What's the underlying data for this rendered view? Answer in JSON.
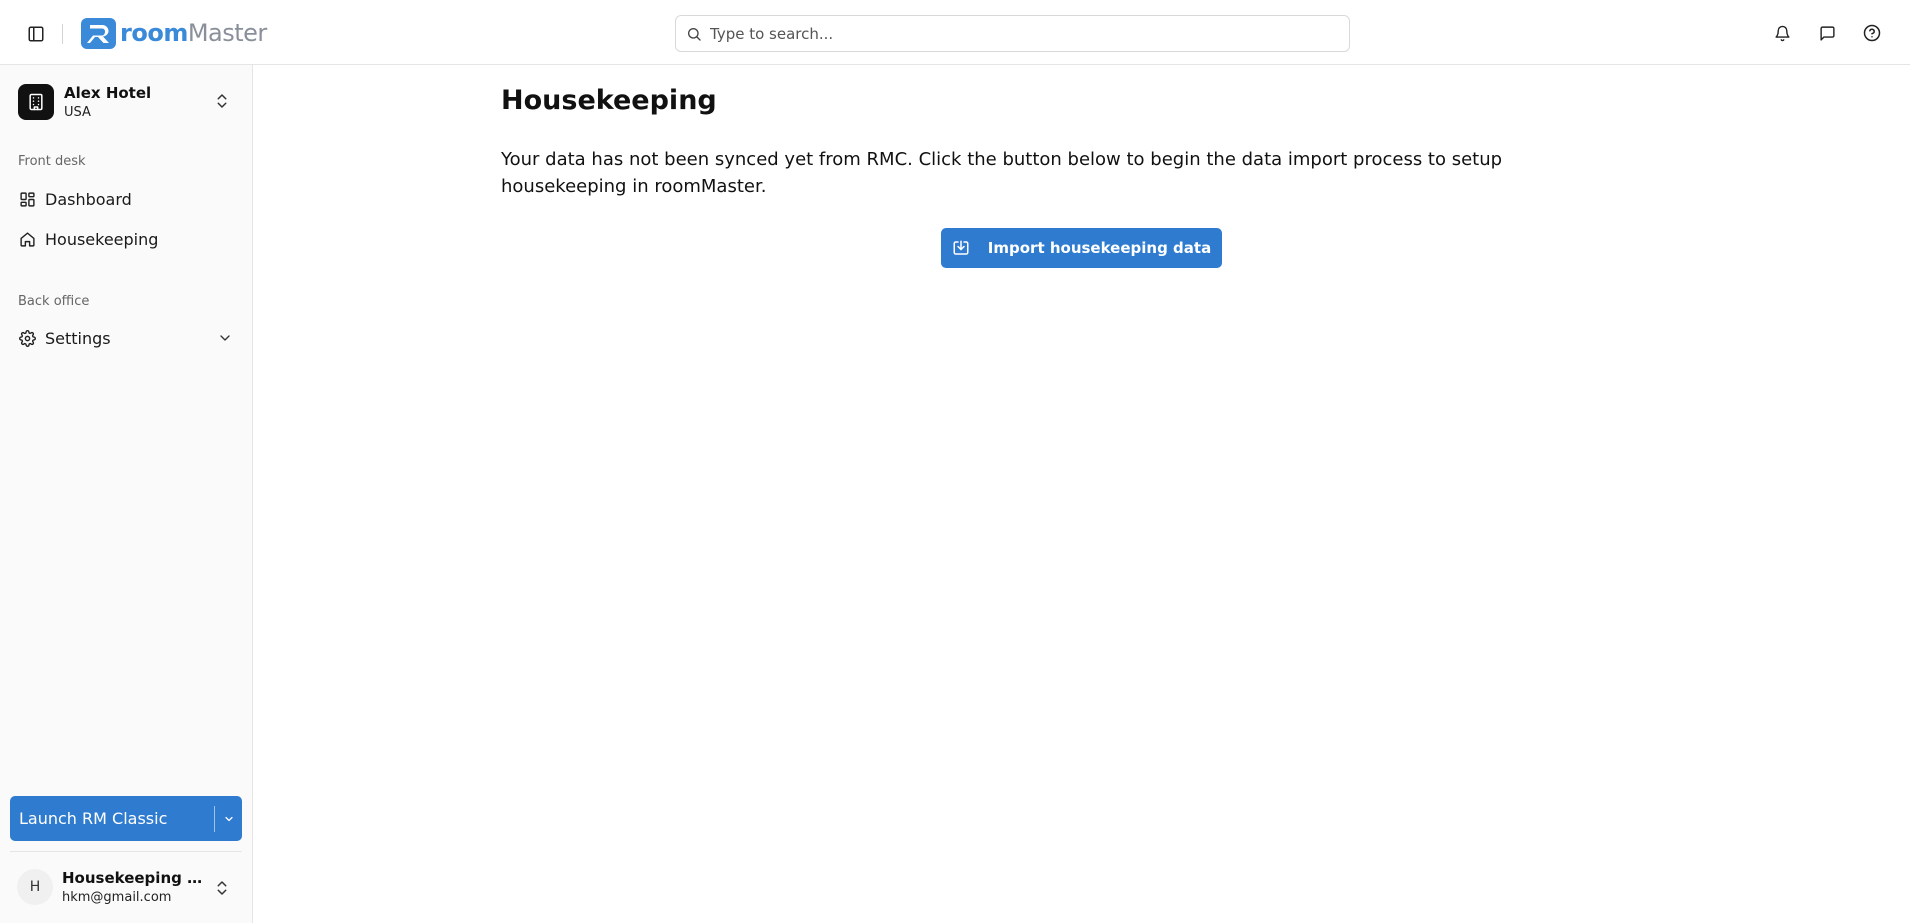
{
  "header": {
    "brand": {
      "room": "room",
      "master": "Master"
    },
    "search": {
      "placeholder": "Type to search..."
    },
    "icons": [
      "sidebar-toggle-icon",
      "bell-icon",
      "message-square-icon",
      "help-circle-icon"
    ]
  },
  "sidebar": {
    "hotel": {
      "name": "Alex Hotel",
      "country": "USA"
    },
    "sections": [
      {
        "label": "Front desk",
        "items": [
          {
            "label": "Dashboard",
            "icon": "dashboard-icon"
          },
          {
            "label": "Housekeeping",
            "icon": "home-icon"
          }
        ]
      },
      {
        "label": "Back office",
        "items": [
          {
            "label": "Settings",
            "icon": "gear-icon"
          }
        ]
      }
    ],
    "launch_label": "Launch RM Classic",
    "user": {
      "initial": "H",
      "name": "Housekeeping Manager",
      "email": "hkm@gmail.com"
    }
  },
  "main": {
    "title": "Housekeeping",
    "description": "Your data has not been synced yet from RMC. Click the button below to begin the data import process to setup housekeeping in roomMaster.",
    "import_label": "Import housekeeping data"
  },
  "colors": {
    "primary": "#2e7bcf",
    "brand_blue": "#3b8ad9",
    "brand_gray": "#8a9099",
    "sidebar_bg": "#fafafa"
  }
}
